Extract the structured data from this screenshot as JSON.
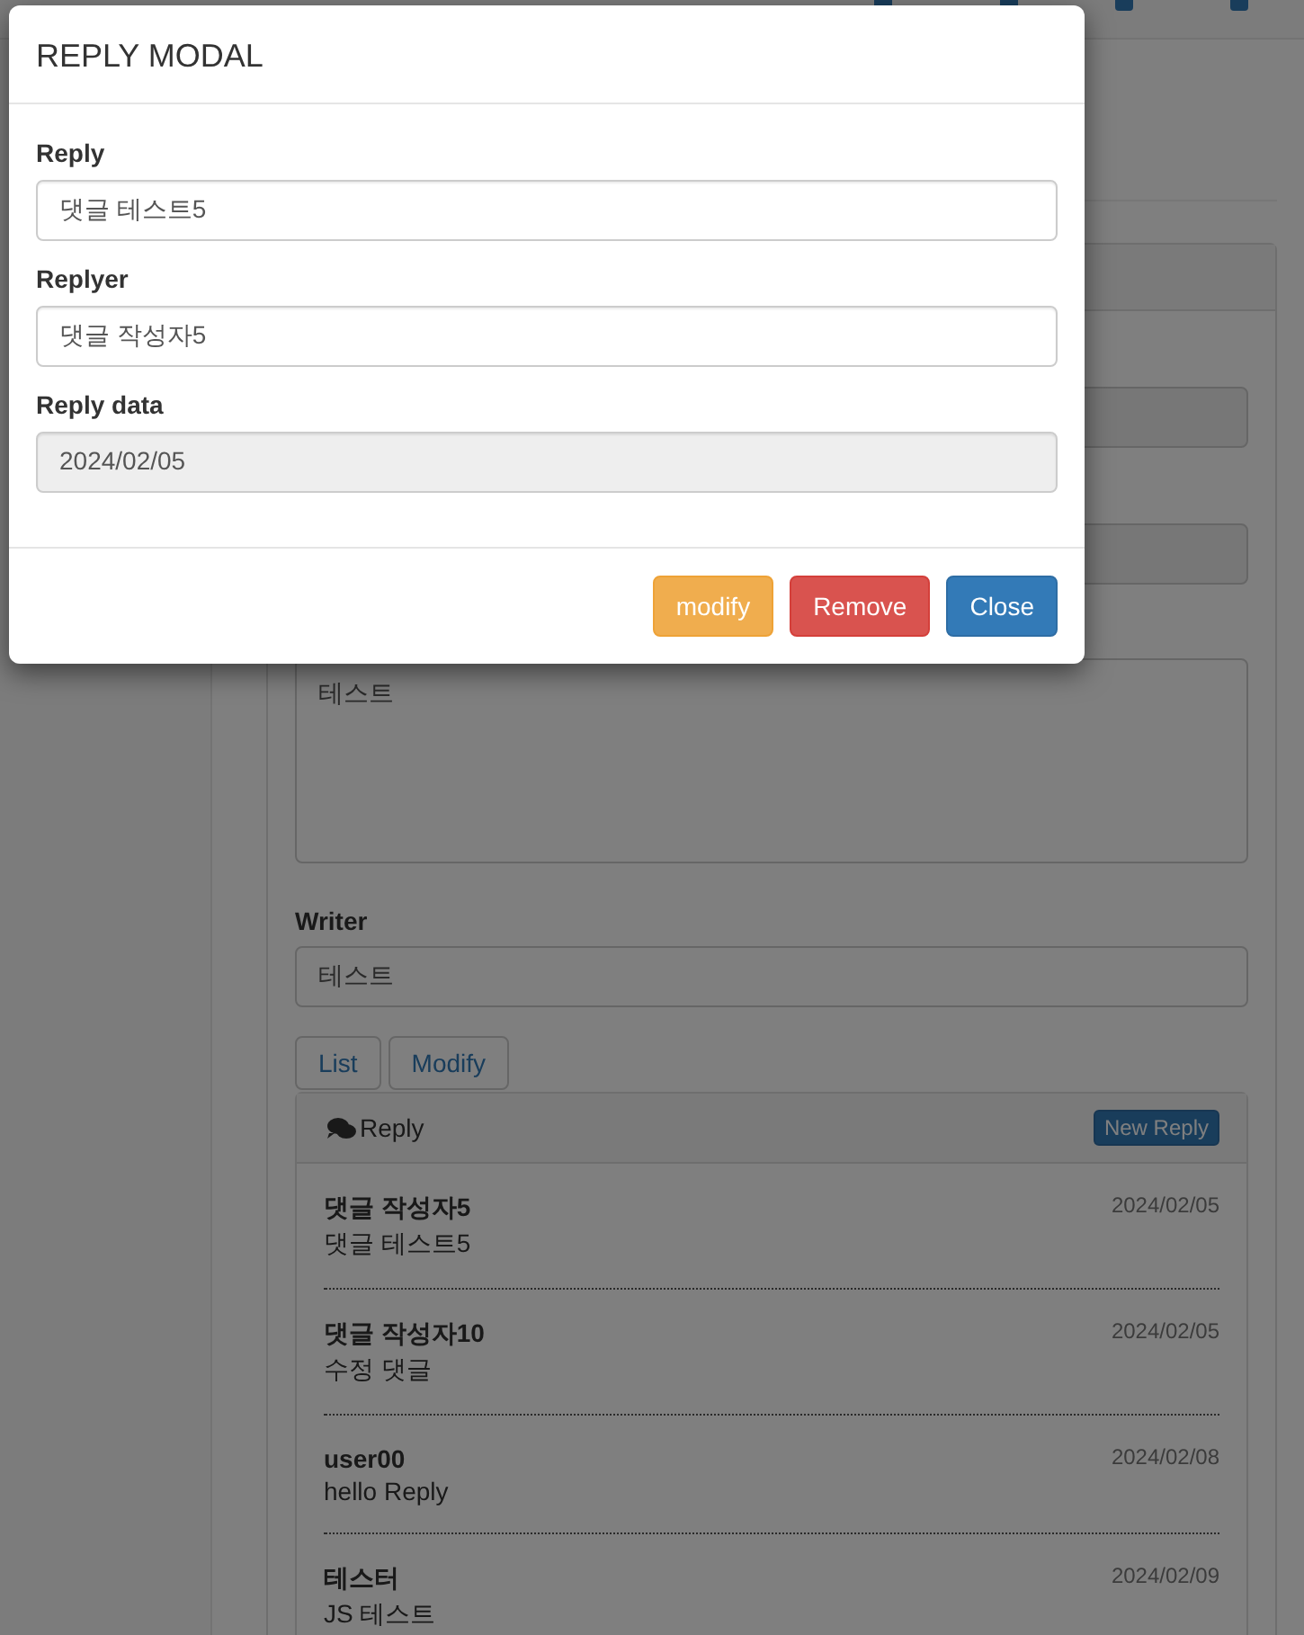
{
  "modal": {
    "title": "REPLY MODAL",
    "fields": [
      {
        "label": "Reply",
        "value": "댓글 테스트5",
        "disabled": false
      },
      {
        "label": "Replyer",
        "value": "댓글 작성자5",
        "disabled": false
      },
      {
        "label": "Reply data",
        "value": "2024/02/05",
        "disabled": true
      }
    ],
    "buttons": [
      {
        "label": "modify",
        "kind": "warning"
      },
      {
        "label": "Remove",
        "kind": "danger"
      },
      {
        "label": "Close",
        "kind": "primary"
      }
    ]
  },
  "page": {
    "content": "테스트",
    "writer_label": "Writer",
    "writer": "테스트",
    "buttons": [
      "List",
      "Modify"
    ],
    "replies": {
      "title": "Reply",
      "new_button": "New Reply",
      "items": [
        {
          "replyer": "댓글 작성자5",
          "date": "2024/02/05",
          "text": "댓글 테스트5"
        },
        {
          "replyer": "댓글 작성자10",
          "date": "2024/02/05",
          "text": "수정 댓글"
        },
        {
          "replyer": "user00",
          "date": "2024/02/08",
          "text": "hello Reply"
        },
        {
          "replyer": "테스터",
          "date": "2024/02/09",
          "text": "JS 테스트"
        }
      ]
    }
  }
}
